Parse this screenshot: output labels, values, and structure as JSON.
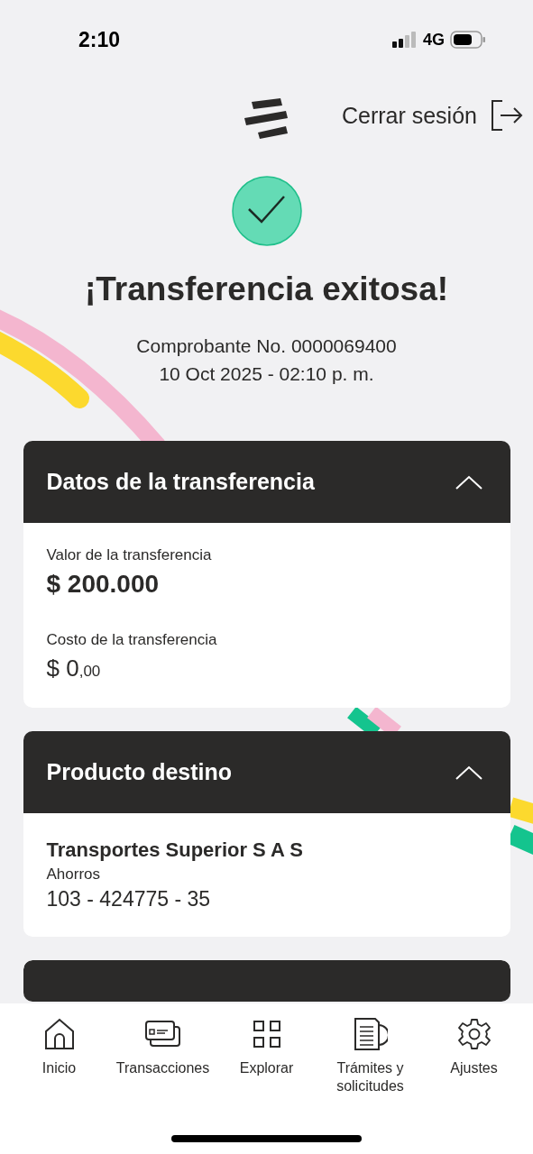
{
  "status_bar": {
    "time": "2:10",
    "network": "4G"
  },
  "header": {
    "logout_label": "Cerrar sesión"
  },
  "result": {
    "title": "¡Transferencia exitosa!",
    "receipt": "Comprobante No. 0000069400",
    "datetime": "10 Oct 2025 - 02:10 p. m."
  },
  "sections": [
    {
      "title": "Datos de la transferencia",
      "expanded": true,
      "kind": "amounts",
      "fields": [
        {
          "label": "Valor de la transferencia",
          "amount": "$ 200.000",
          "bold": true
        },
        {
          "label": "Costo de la transferencia",
          "amount": "$ 0",
          "cents": ",00",
          "bold": false
        }
      ]
    },
    {
      "title": "Producto destino",
      "expanded": true,
      "kind": "account",
      "name": "Transportes Superior S A S",
      "account_type": "Ahorros",
      "number": "103 - 424775 - 35"
    },
    {
      "kind": "peek"
    }
  ],
  "nav": [
    {
      "label": "Inicio",
      "kind": "home"
    },
    {
      "label": "Transacciones",
      "kind": "cards"
    },
    {
      "label": "Explorar",
      "kind": "grid"
    },
    {
      "label": "Trámites y solicitudes",
      "kind": "docs"
    },
    {
      "label": "Ajustes",
      "kind": "gear"
    }
  ]
}
